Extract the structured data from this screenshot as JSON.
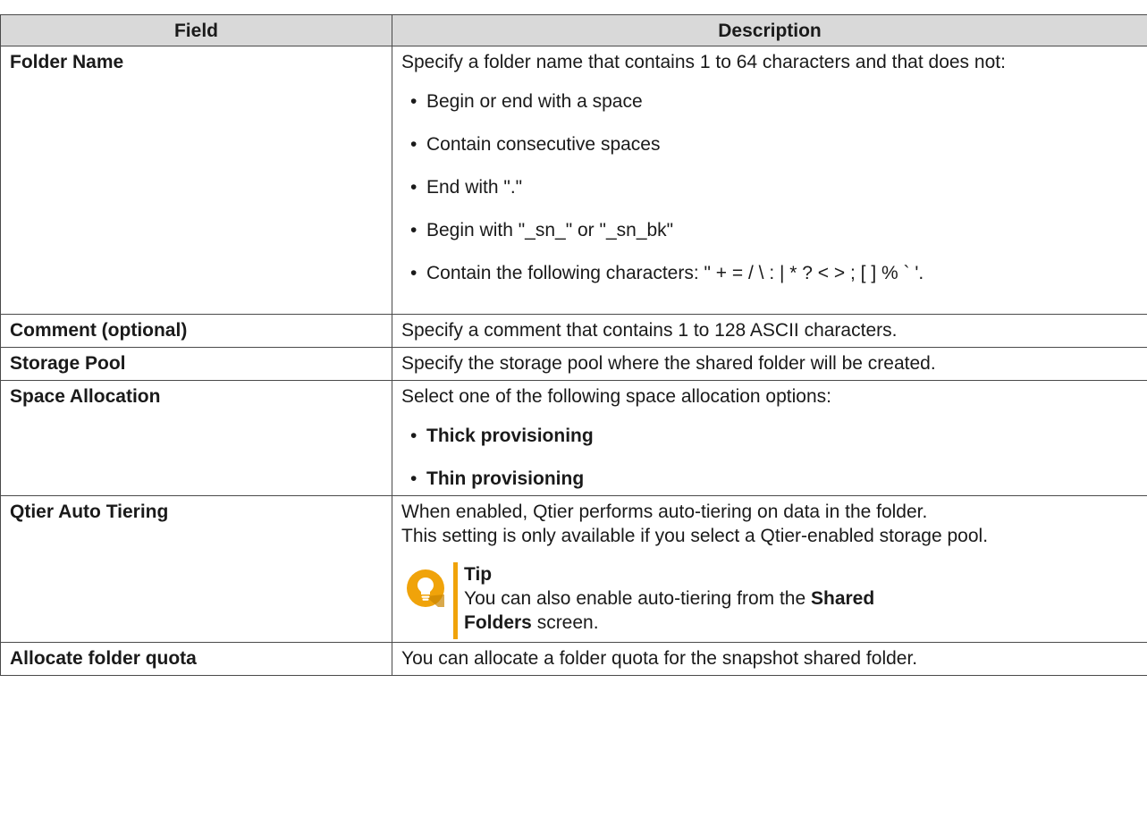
{
  "table": {
    "headers": [
      "Field",
      "Description"
    ],
    "rows": {
      "folder_name": {
        "field": "Folder Name",
        "intro": "Specify a folder name that contains 1 to 64 characters and that does not:",
        "bullets": [
          "Begin or end with a space",
          "Contain consecutive spaces",
          "End with \".\"",
          "Begin with \"_sn_\" or \"_sn_bk\"",
          "Contain the following characters: \" + = / \\ : | * ? < > ; [ ] % ` '."
        ]
      },
      "comment": {
        "field": "Comment (optional)",
        "desc": "Specify a comment that contains 1 to 128 ASCII characters."
      },
      "storage_pool": {
        "field": "Storage Pool",
        "desc": "Specify the storage pool where the shared folder will be created."
      },
      "space_allocation": {
        "field": "Space Allocation",
        "intro": "Select one of the following space allocation options:",
        "bullets": [
          "Thick provisioning",
          "Thin provisioning"
        ]
      },
      "qtier": {
        "field": "Qtier Auto Tiering",
        "line1": "When enabled, Qtier performs auto-tiering on data in the folder.",
        "line2": "This setting is only available if you select a Qtier-enabled storage pool.",
        "tip": {
          "icon": "lightbulb-icon",
          "title": "Tip",
          "text_before": "You can also enable auto-tiering from the ",
          "text_bold_1": "Shared",
          "text_bold_2": "Folders",
          "text_after": " screen."
        }
      },
      "quota": {
        "field": "Allocate folder quota",
        "desc": "You can allocate a folder quota for the snapshot shared folder."
      }
    },
    "bullet_char": "•"
  },
  "colors": {
    "header_bg": "#d9d9d9",
    "border": "#4a4a4a",
    "tip_accent": "#f0a30a",
    "tip_icon": "#f0a30a"
  }
}
